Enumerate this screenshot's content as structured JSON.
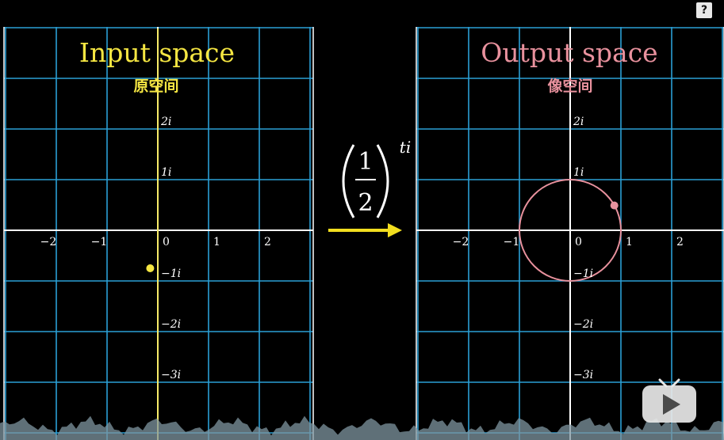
{
  "colors": {
    "background": "#000000",
    "grid": "#2a9fd6",
    "axis": "#ffffff",
    "input_accent": "#f5e642",
    "output_accent": "#e8919d",
    "arrow": "#f2de1f"
  },
  "left_panel": {
    "title": "Input space",
    "subtitle": "原空间",
    "x_ticks": [
      "−2",
      "−1",
      "0",
      "1",
      "2"
    ],
    "y_ticks": [
      "2i",
      "1i",
      "−1i",
      "−2i",
      "−3i"
    ],
    "point": {
      "re": -0.15,
      "im": -0.75
    }
  },
  "right_panel": {
    "title": "Output space",
    "subtitle": "像空间",
    "x_ticks": [
      "−2",
      "−1",
      "0",
      "1",
      "2"
    ],
    "y_ticks": [
      "2i",
      "1i",
      "−1i",
      "−2i",
      "−3i"
    ],
    "unit_circle": {
      "radius": 1
    },
    "point": {
      "re": 0.87,
      "im": 0.49
    }
  },
  "transform": {
    "numerator": "1",
    "denominator": "2",
    "exponent": "ti"
  },
  "help_button": {
    "label": "?",
    "icon": "help-icon"
  },
  "play_button": {
    "icon": "tv-play-icon"
  }
}
